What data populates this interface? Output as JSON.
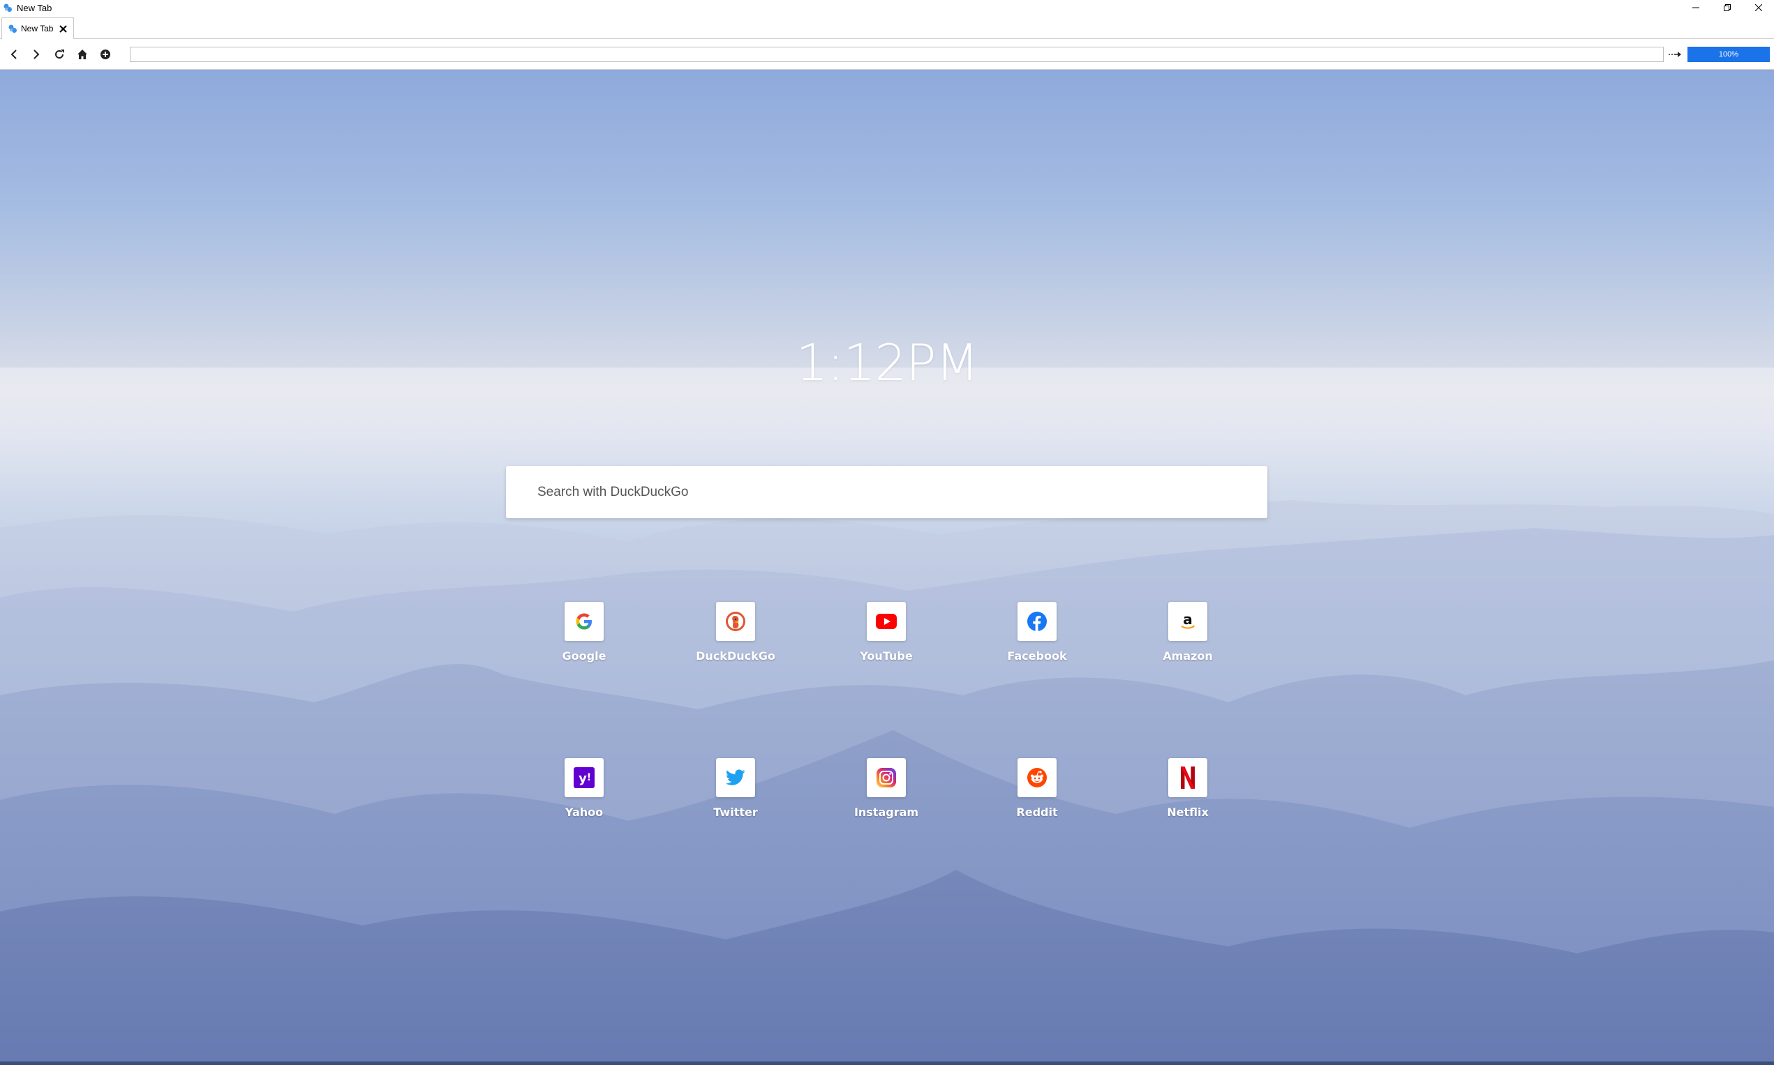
{
  "window": {
    "title": "New Tab",
    "controls": [
      "minimize",
      "restore",
      "close"
    ]
  },
  "tabs": [
    {
      "label": "New Tab",
      "active": true
    }
  ],
  "navbar": {
    "address_value": "",
    "zoom": "100%",
    "zoom_color": "#1a73e8"
  },
  "newtab": {
    "clock": "1:12PM",
    "search_placeholder": "Search with DuckDuckGo",
    "shortcuts": [
      {
        "label": "Google",
        "icon": "google-icon"
      },
      {
        "label": "DuckDuckGo",
        "icon": "duckduckgo-icon"
      },
      {
        "label": "YouTube",
        "icon": "youtube-icon"
      },
      {
        "label": "Facebook",
        "icon": "facebook-icon"
      },
      {
        "label": "Amazon",
        "icon": "amazon-icon"
      },
      {
        "label": "Yahoo",
        "icon": "yahoo-icon"
      },
      {
        "label": "Twitter",
        "icon": "twitter-icon"
      },
      {
        "label": "Instagram",
        "icon": "instagram-icon"
      },
      {
        "label": "Reddit",
        "icon": "reddit-icon"
      },
      {
        "label": "Netflix",
        "icon": "netflix-icon"
      }
    ]
  }
}
